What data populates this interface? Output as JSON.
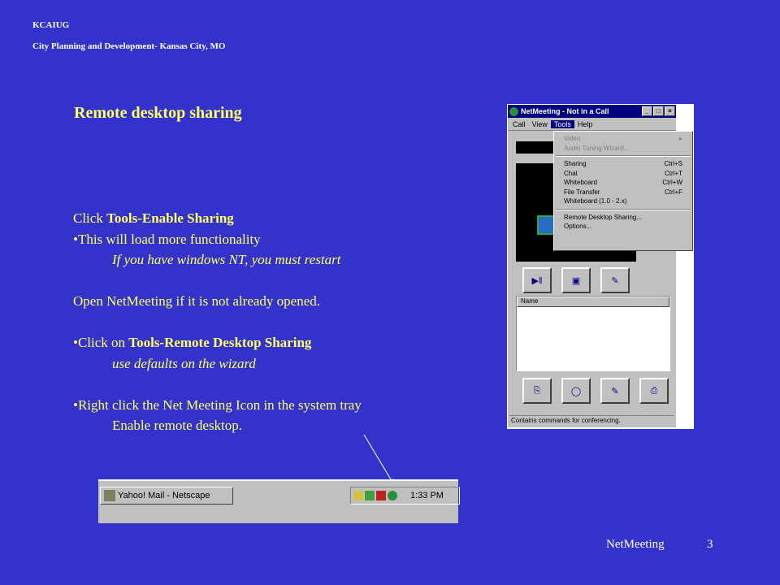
{
  "header": {
    "org": "KCAIUG",
    "dept": "City Planning and Development- Kansas City, MO"
  },
  "slide": {
    "title": "Remote desktop sharing",
    "lines": {
      "l1_prefix": "Click ",
      "l1_bold": "Tools-Enable Sharing",
      "l2": "•This will load more functionality",
      "l3": "If you have windows NT, you must restart",
      "l4": "Open NetMeeting if it is not already opened.",
      "l5_prefix": "•Click on ",
      "l5_bold": "Tools-Remote Desktop Sharing",
      "l6": "use defaults on the wizard",
      "l7": "•Right click the Net Meeting Icon in the system tray",
      "l8": "Enable remote desktop."
    }
  },
  "footer": {
    "label": "NetMeeting",
    "page": "3"
  },
  "netmeeting": {
    "title": "NetMeeting - Not in a Call",
    "title_buttons": {
      "minimize": "_",
      "maximize": "□",
      "close": "×"
    },
    "menu": [
      "Call",
      "View",
      "Tools",
      "Help"
    ],
    "tools_menu": [
      {
        "label": "Video",
        "shortcut": "▸"
      },
      {
        "label": "Audio Tuning Wizard...",
        "shortcut": ""
      },
      {
        "label": "Sharing",
        "shortcut": "Ctrl+S"
      },
      {
        "label": "Chat",
        "shortcut": "Ctrl+T"
      },
      {
        "label": "Whiteboard",
        "shortcut": "Ctrl+W"
      },
      {
        "label": "File Transfer",
        "shortcut": "Ctrl+F"
      },
      {
        "label": "Whiteboard (1.0 - 2.x)",
        "shortcut": ""
      },
      {
        "label": "Remote Desktop Sharing...",
        "shortcut": ""
      },
      {
        "label": "Options...",
        "shortcut": ""
      }
    ],
    "list_header": "Name",
    "status": "Contains commands for conferencing."
  },
  "taskbar": {
    "task": "Yahoo! Mail - Netscape",
    "clock": "1:33 PM"
  },
  "colors": {
    "background": "#3333cc",
    "body_text": "#ffff66",
    "header_text": "#ffffff"
  }
}
